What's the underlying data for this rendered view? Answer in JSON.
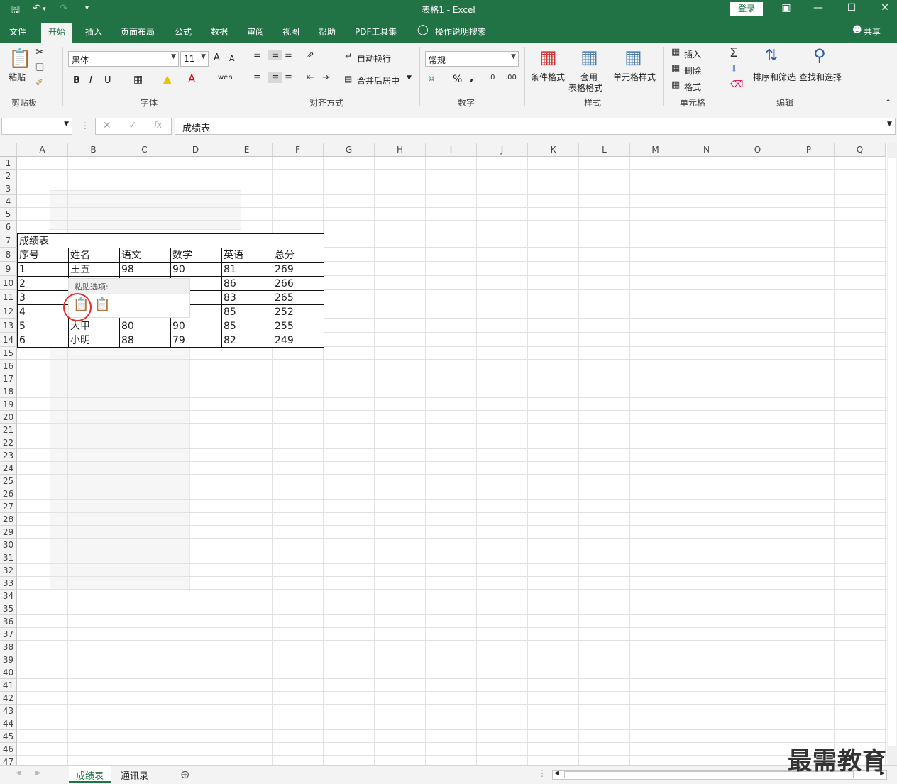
{
  "titlebar": {
    "title": "表格1  -  Excel",
    "login": "登录",
    "save_icon": "save-icon",
    "undo_icon": "undo-icon",
    "redo_icon": "redo-icon"
  },
  "menu": {
    "tabs": [
      "文件",
      "开始",
      "插入",
      "页面布局",
      "公式",
      "数据",
      "审阅",
      "视图",
      "帮助",
      "PDF工具集"
    ],
    "search": "操作说明搜索",
    "share": "共享",
    "active": "开始"
  },
  "ribbon": {
    "clipboard": {
      "paste": "粘贴",
      "label": "剪贴板"
    },
    "font": {
      "name": "黑体",
      "size": "11",
      "bold": "B",
      "italic": "I",
      "underline": "U",
      "label": "字体",
      "grow": "A",
      "shrink": "A",
      "phonetic": "wén"
    },
    "alignment": {
      "wrap": "自动换行",
      "merge": "合并后居中",
      "label": "对齐方式"
    },
    "number": {
      "format": "常规",
      "percent": "%",
      "comma": ",",
      "label": "数字"
    },
    "styles": {
      "conditional": "条件格式",
      "table_format_1": "套用",
      "table_format_2": "表格格式",
      "cell_style": "单元格样式",
      "label": "样式"
    },
    "cells": {
      "insert": "插入",
      "delete": "删除",
      "format": "格式",
      "label": "单元格"
    },
    "editing": {
      "sort": "排序和筛选",
      "find": "查找和选择",
      "label": "编辑"
    }
  },
  "formula_bar": {
    "name_box": "",
    "content": "成绩表"
  },
  "columns": [
    "A",
    "B",
    "C",
    "D",
    "E",
    "F",
    "G",
    "H",
    "I",
    "J",
    "K",
    "L",
    "M",
    "N",
    "O",
    "P",
    "Q"
  ],
  "rows": [
    "1",
    "2",
    "3",
    "4",
    "5",
    "6",
    "7",
    "8",
    "9",
    "10",
    "11",
    "12",
    "13",
    "14",
    "15",
    "16",
    "17",
    "18",
    "19",
    "20",
    "21",
    "22",
    "23",
    "24",
    "25",
    "26",
    "27",
    "28",
    "29",
    "30",
    "31",
    "32",
    "33",
    "34",
    "35",
    "36",
    "37",
    "38",
    "39",
    "40",
    "41",
    "42",
    "43",
    "44",
    "45",
    "46",
    "47"
  ],
  "table": {
    "title": "成绩表",
    "headers": [
      "序号",
      "姓名",
      "语文",
      "数学",
      "英语",
      "总分"
    ],
    "rows": [
      [
        "1",
        "王五",
        "98",
        "90",
        "81",
        "269"
      ],
      [
        "2",
        "",
        "",
        "",
        "86",
        "266"
      ],
      [
        "3",
        "",
        "",
        "",
        "83",
        "265"
      ],
      [
        "4",
        "",
        "",
        "",
        "85",
        "252"
      ],
      [
        "5",
        "大甲",
        "80",
        "90",
        "85",
        "255"
      ],
      [
        "6",
        "小明",
        "88",
        "79",
        "82",
        "249"
      ]
    ]
  },
  "paste_popup": {
    "title": "粘贴选项:"
  },
  "sheet_tabs": [
    "成绩表",
    "通讯录"
  ],
  "active_sheet": "成绩表",
  "watermark": "最需教育"
}
